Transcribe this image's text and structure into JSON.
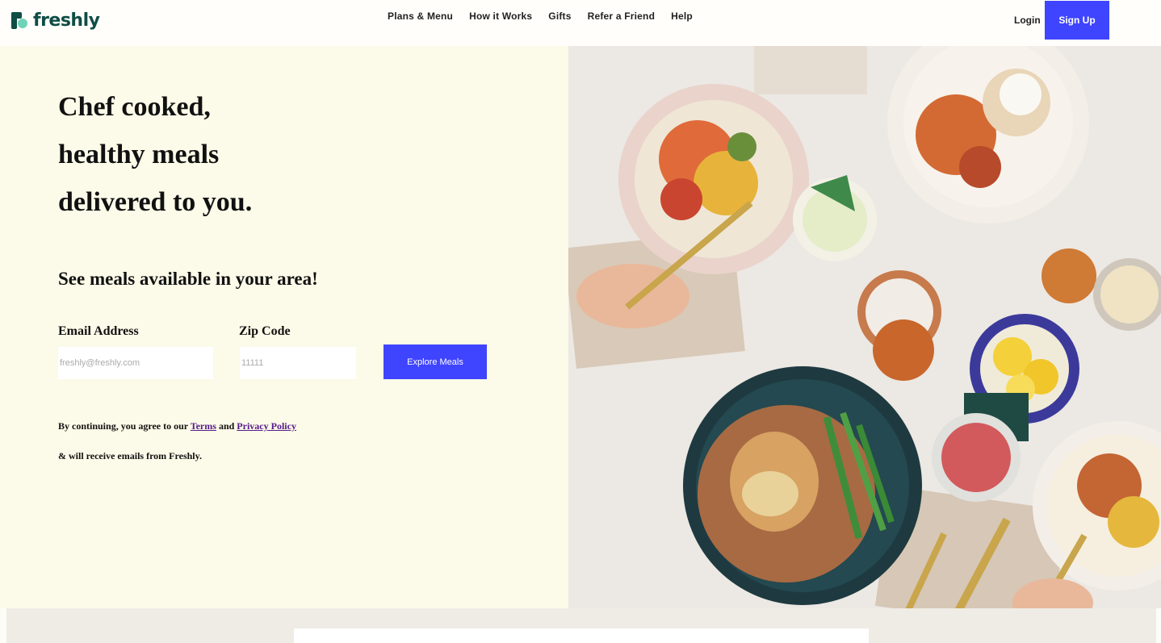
{
  "header": {
    "logo_text": "freshly",
    "nav": [
      "Plans & Menu",
      "How it Works",
      "Gifts",
      "Refer a Friend",
      "Help"
    ],
    "login_label": "Login",
    "signup_label": "Sign Up"
  },
  "hero": {
    "headline_lines": [
      "Chef cooked,",
      "healthy meals",
      "delivered to you."
    ],
    "subhead": "See meals available in your area!",
    "email_label": "Email Address",
    "email_placeholder": "freshly@freshly.com",
    "zip_label": "Zip Code",
    "zip_placeholder": "11111",
    "cta_label": "Explore Meals",
    "legal_prefix": "By continuing, you agree to our",
    "terms_label": "Terms",
    "legal_and": "and",
    "privacy_label": "Privacy Policy",
    "legal_line2": "& will receive emails from Freshly."
  },
  "colors": {
    "brand_green": "#0f4d45",
    "accent_blue": "#3f44ff",
    "hero_bg": "#fcfae8",
    "link_purple": "#551a8b"
  }
}
